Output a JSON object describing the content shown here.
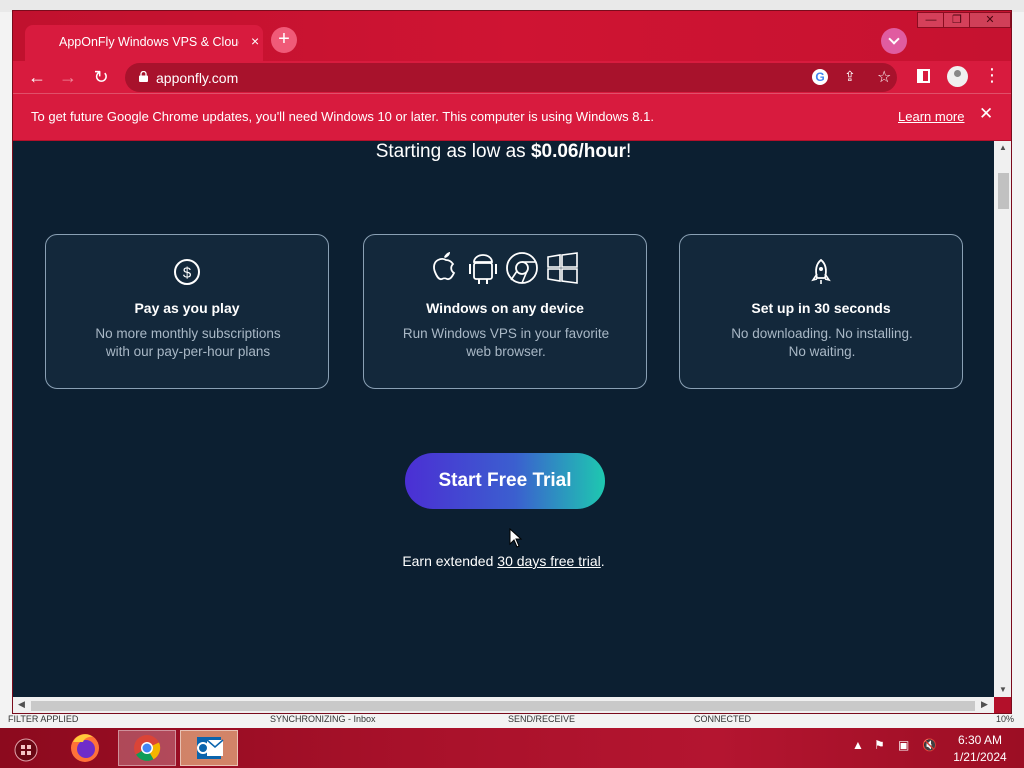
{
  "browser": {
    "tab_title": "AppOnFly Windows VPS & Cloud",
    "tab_close": "×",
    "new_tab": "+",
    "url": "apponfly.com",
    "google_icon": "G",
    "infobar_text": "To get future Google Chrome updates, you'll need Windows 10 or later. This computer is using Windows 8.1.",
    "infobar_link": "Learn more",
    "infobar_close": "✕",
    "icons": [
      "back-arrow-icon",
      "forward-arrow-icon",
      "reload-icon",
      "lock-icon",
      "google-icon",
      "share-icon",
      "star-icon",
      "side-panel-icon",
      "profile-icon",
      "menu-icon"
    ]
  },
  "page": {
    "headline_prefix": "Starting as low as ",
    "headline_price": "$0.06/hour",
    "headline_suffix": "!",
    "cards": [
      {
        "title": "Pay as you play",
        "desc_line1": "No more monthly subscriptions",
        "desc_line2": "with our pay-per-hour plans",
        "icon": "dollar-coin-icon"
      },
      {
        "title": "Windows on any device",
        "desc_line1": "Run Windows VPS in your favorite",
        "desc_line2": "web browser.",
        "icon": "platforms-icons"
      },
      {
        "title": "Set up in 30 seconds",
        "desc_line1": "No downloading. No installing.",
        "desc_line2": "No waiting.",
        "icon": "rocket-icon"
      }
    ],
    "cta_label": "Start Free Trial",
    "cta_note_prefix": "Earn extended ",
    "cta_note_link": "30 days free trial",
    "cta_note_suffix": "."
  },
  "outlook_status": {
    "filter": "FILTER APPLIED",
    "sync": "SYNCHRONIZING - Inbox",
    "send": "SEND/RECEIVE",
    "connected": "CONNECTED",
    "zoom": "10%"
  },
  "taskbar": {
    "apps": [
      "start-orb-icon",
      "firefox-icon",
      "chrome-icon",
      "outlook-icon"
    ],
    "time": "6:30 AM",
    "date": "1/21/2024"
  },
  "colors": {
    "browser_frame": "#d81b3e",
    "page_bg": "#0c1f31",
    "cta_gradient_start": "#4b2fd4",
    "cta_gradient_end": "#1ec8b0"
  }
}
